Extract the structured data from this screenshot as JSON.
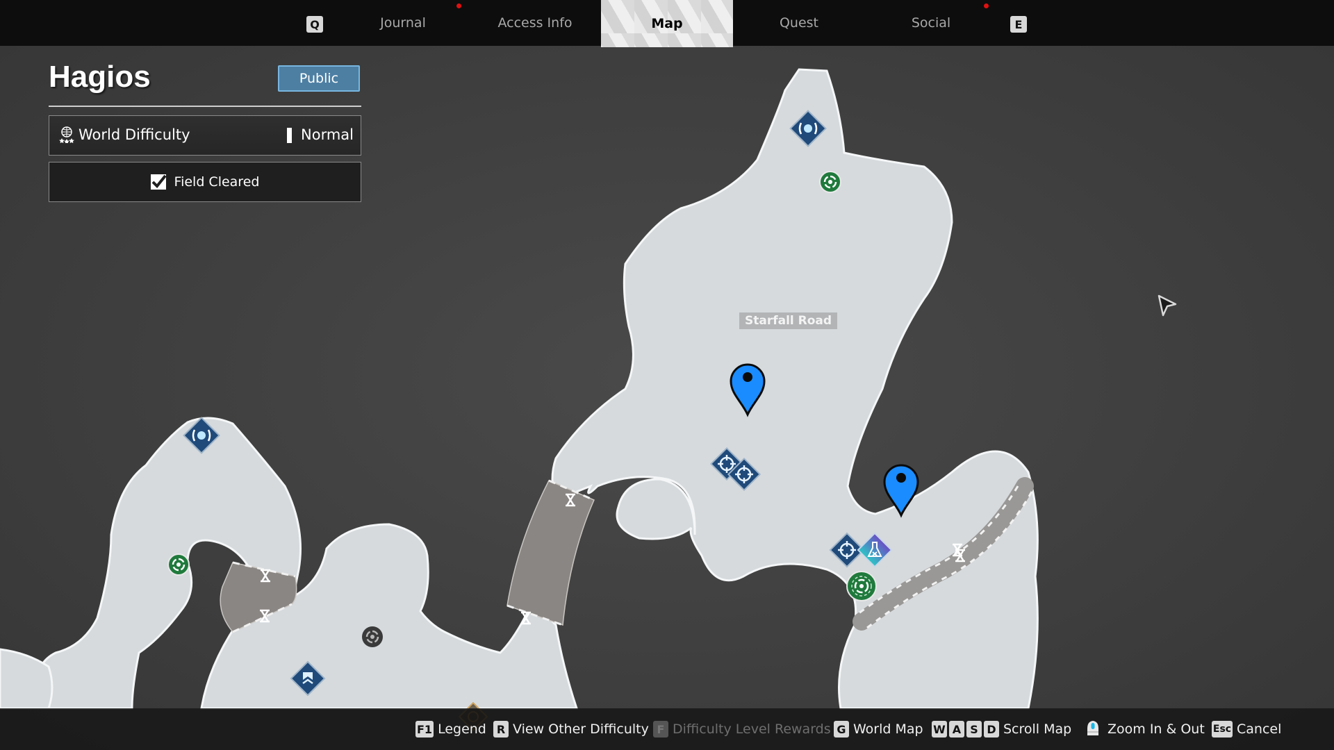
{
  "topnav": {
    "prev_key": "Q",
    "next_key": "E",
    "tabs": [
      {
        "label": "Journal",
        "notification": true
      },
      {
        "label": "Access Info",
        "notification": false
      },
      {
        "label": "Map",
        "active": true,
        "notification": false
      },
      {
        "label": "Quest",
        "notification": false
      },
      {
        "label": "Social",
        "notification": true
      }
    ]
  },
  "panel": {
    "title": "Hagios",
    "visibility_button": "Public",
    "world_difficulty_label": "World Difficulty",
    "world_difficulty_value": "Normal",
    "field_status": "Field Cleared",
    "field_cleared": true
  },
  "map": {
    "area_label": "Starfall Road",
    "markers": [
      {
        "type": "waypoint-pin",
        "color": "#1a8cff"
      },
      {
        "type": "waypoint-pin",
        "color": "#1a8cff"
      },
      {
        "type": "teleport-diamond"
      },
      {
        "type": "teleport-diamond"
      },
      {
        "type": "green-objective"
      },
      {
        "type": "green-objective"
      },
      {
        "type": "green-objective"
      },
      {
        "type": "crosshair-diamond"
      },
      {
        "type": "crosshair-diamond"
      },
      {
        "type": "crosshair-diamond"
      },
      {
        "type": "research-flask-diamond"
      },
      {
        "type": "chevron-diamond"
      },
      {
        "type": "inactive-objective"
      },
      {
        "type": "gate-marker"
      }
    ]
  },
  "bottombar": {
    "hints": [
      {
        "keys": [
          "F1"
        ],
        "label": "Legend",
        "enabled": true
      },
      {
        "keys": [
          "R"
        ],
        "label": "View Other Difficulty",
        "enabled": true
      },
      {
        "keys": [
          "F"
        ],
        "label": "Difficulty Level Rewards",
        "enabled": false
      },
      {
        "keys": [
          "G"
        ],
        "label": "World Map",
        "enabled": true
      },
      {
        "keys": [
          "W",
          "A",
          "S",
          "D"
        ],
        "label": "Scroll Map",
        "enabled": true
      },
      {
        "keys": [
          "mouse-wheel"
        ],
        "label": "Zoom In & Out",
        "enabled": true
      },
      {
        "keys": [
          "Esc"
        ],
        "label": "Cancel",
        "enabled": true
      }
    ]
  },
  "colors": {
    "accent_blue": "#4d7fa3",
    "pin_blue": "#1a8cff",
    "notification_red": "#e01010",
    "objective_green": "#1f7a3c",
    "marker_navy": "#1f4a7a"
  }
}
